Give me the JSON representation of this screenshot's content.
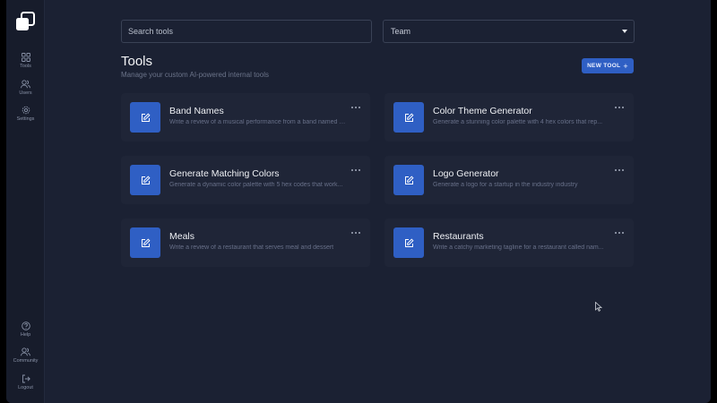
{
  "sidebar": {
    "items": [
      {
        "label": "Tools",
        "icon": "grid-icon"
      },
      {
        "label": "Users",
        "icon": "users-icon"
      },
      {
        "label": "Settings",
        "icon": "gear-icon"
      }
    ],
    "bottom": [
      {
        "label": "Help",
        "icon": "help-icon"
      },
      {
        "label": "Community",
        "icon": "community-icon"
      },
      {
        "label": "Logout",
        "icon": "logout-icon"
      }
    ]
  },
  "search": {
    "placeholder": "Search tools",
    "value": ""
  },
  "filter": {
    "selected": "Team"
  },
  "page": {
    "title": "Tools",
    "subtitle": "Manage your custom AI-powered internal tools",
    "new_button": "NEW TOOL",
    "new_button_icon": "+"
  },
  "tools": [
    {
      "name": "Band Names",
      "description": "Write a review of a musical performance from a band named wa...",
      "icon": "edit-icon"
    },
    {
      "name": "Color Theme Generator",
      "description": "Generate a stunning color palette with 4 hex colors that rep...",
      "icon": "edit-icon"
    },
    {
      "name": "Generate Matching Colors",
      "description": "Generate a dynamic color palette with 5 hex codes that work...",
      "icon": "edit-icon"
    },
    {
      "name": "Logo Generator",
      "description": "Generate a logo for a startup in the industry industry",
      "icon": "edit-icon"
    },
    {
      "name": "Meals",
      "description": "Write a review of a restaurant that serves meal and dessert",
      "icon": "edit-icon"
    },
    {
      "name": "Restaurants",
      "description": "Write a catchy marketing tagline for a restaurant called nam...",
      "icon": "edit-icon"
    }
  ],
  "colors": {
    "accent": "#2f5fc4",
    "background": "#1b2133",
    "card": "#1f2537",
    "sidebar": "#171c2b"
  }
}
